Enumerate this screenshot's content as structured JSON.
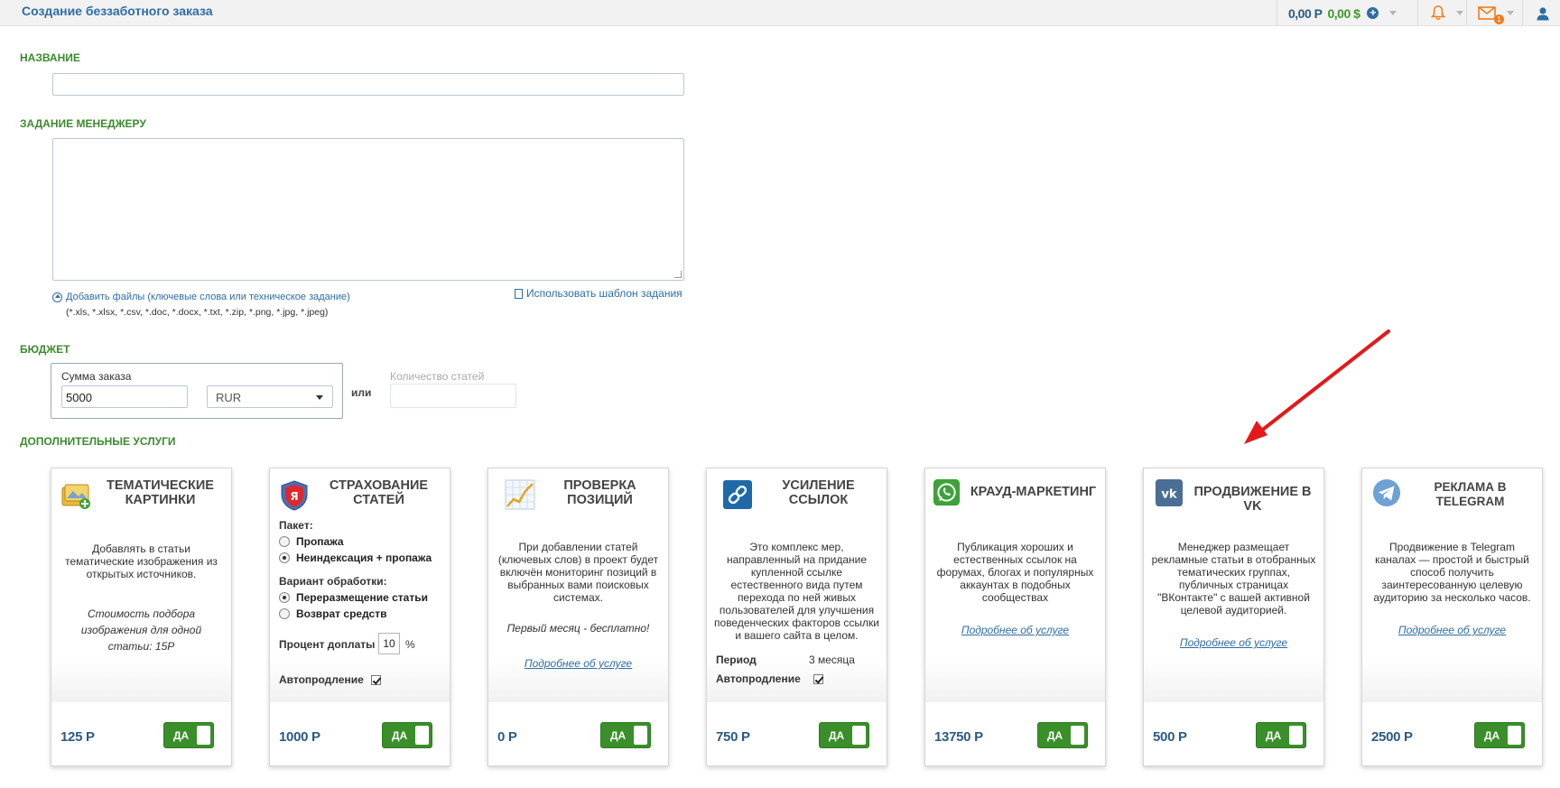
{
  "header": {
    "title": "Создание беззаботного заказа",
    "balance_rub": "0,00 Р",
    "balance_usd": "0,00 $",
    "mail_badge": "1"
  },
  "form": {
    "name_label": "НАЗВАНИЕ",
    "task_label": "ЗАДАНИЕ МЕНЕДЖЕРУ",
    "add_files": "Добавить файлы (ключевые слова или техническое задание)",
    "file_types": "(*.xls, *.xlsx, *.csv, *.doc, *.docx, *.txt, *.zip, *.png, *.jpg, *.jpeg)",
    "use_template": "Использовать шаблон задания",
    "budget_label": "БЮДЖЕТ",
    "sum_label": "Сумма заказа",
    "sum_value": "5000",
    "currency": "RUR",
    "or": "или",
    "count_label": "Количество статей",
    "services_label": "ДОПОЛНИТЕЛЬНЫЕ УСЛУГИ"
  },
  "cards": [
    {
      "title": "ТЕМАТИЧЕСКИЕ КАРТИНКИ",
      "icon": "images-add-icon",
      "desc": "Добавлять в статьи тематические изображения из открытых источников.",
      "note": "Стоимость подбора изображения для одной статьи: 15Р",
      "price": "125 Р",
      "toggle": "ДА"
    },
    {
      "title": "СТРАХОВАНИЕ СТАТЕЙ",
      "icon": "yandex-shield-icon",
      "package_label": "Пакет:",
      "package_options": [
        "Пропажа",
        "Неиндексация + пропажа"
      ],
      "variant_label": "Вариант обработки:",
      "variant_options": [
        "Переразмещение статьи",
        "Возврат средств"
      ],
      "percent_label": "Процент доплаты",
      "percent_value": "10",
      "percent_unit": "%",
      "autorenew_label": "Автопродление",
      "price": "1000 Р",
      "toggle": "ДА"
    },
    {
      "title": "ПРОВЕРКА ПОЗИЦИЙ",
      "icon": "chart-growth-icon",
      "desc": "При добавлении статей (ключевых слов) в проект будет включён мониторинг позиций в выбранных вами поисковых системах.",
      "note": "Первый месяц - бесплатно!",
      "link": "Подробнее об услуге",
      "price": "0 Р",
      "toggle": "ДА"
    },
    {
      "title": "УСИЛЕНИЕ ССЫЛОК",
      "icon": "link-icon",
      "desc": "Это комплекс мер, направленный на придание купленной ссылке естественного вида путем перехода по ней живых пользователей для улучшения поведенческих факторов ссылки и вашего сайта в целом.",
      "period_label": "Период",
      "period_value": "3 месяца",
      "autorenew_label": "Автопродление",
      "price": "750 Р",
      "toggle": "ДА"
    },
    {
      "title": "КРАУД-МАРКЕТИНГ",
      "icon": "whatsapp-icon",
      "desc": "Публикация хороших и естественных ссылок на форумах, блогах и популярных аккаунтах в подобных сообществах",
      "link": "Подробнее об услуге",
      "price": "13750 Р",
      "toggle": "ДА"
    },
    {
      "title": "ПРОДВИЖЕНИЕ В VK",
      "icon": "vk-icon",
      "desc": "Менеджер размещает рекламные статьи в отобранных тематических группах, публичных страницах \"ВКонтакте\" с вашей активной целевой аудиторией.",
      "link": "Подробнее об услуге",
      "price": "500 Р",
      "toggle": "ДА"
    },
    {
      "title": "РЕКЛАМА В TELEGRAM",
      "icon": "telegram-icon",
      "desc": "Продвижение в Telegram каналах — простой и быстрый способ получить заинтересованную целевую аудиторию за несколько часов.",
      "link": "Подробнее об услуге",
      "price": "2500 Р",
      "toggle": "ДА"
    }
  ],
  "colors": {
    "accent_blue": "#2e6da4",
    "section_green": "#3c8a2e",
    "toggle_green": "#3a8f2a",
    "arrow_red": "#e3191b"
  }
}
